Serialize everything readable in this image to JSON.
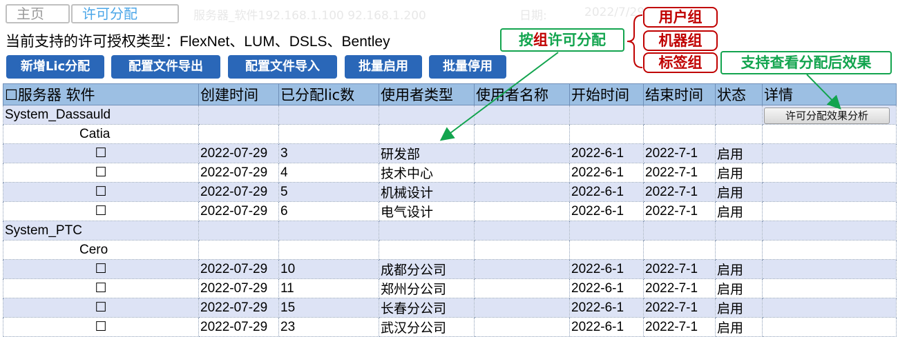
{
  "tabs": {
    "home": "主页",
    "active": "许可分配"
  },
  "faded_header": {
    "server_info": "服务器_软件192.168.1.100 92.168.1.200",
    "date_label": "日期:",
    "date_value": "2022/7/29"
  },
  "support_line": {
    "label": "当前支持的许可授权类型：",
    "types": "FlexNet、LUM、DSLS、Bentley"
  },
  "toolbar": {
    "add_lic": "新增Lic分配",
    "export_config": "配置文件导出",
    "import_config": "配置文件导入",
    "batch_enable": "批量启用",
    "batch_disable": "批量停用"
  },
  "annotations": {
    "group_alloc": {
      "prefix": "按",
      "highlight": "组",
      "suffix": "许可分配"
    },
    "user_group": "用户组",
    "machine_group": "机器组",
    "tag_group": "标签组",
    "view_effect": "支持查看分配后效果"
  },
  "table": {
    "headers": {
      "server_software": "☐服务器 软件",
      "created": "创建时间",
      "lic_count": "已分配lic数",
      "user_type": "使用者类型",
      "user_name": "使用者名称",
      "start": "开始时间",
      "end": "结束时间",
      "status": "状态",
      "detail": "详情"
    },
    "detail_button": "许可分配效果分析",
    "systems": [
      {
        "name": "System_Dassauld",
        "software": "Catia",
        "rows": [
          {
            "check": "☐",
            "created": "2022-07-29",
            "count": "3",
            "user_type": "研发部",
            "user_name": "",
            "start": "2022-6-1",
            "end": "2022-7-1",
            "status": "启用"
          },
          {
            "check": "☐",
            "created": "2022-07-29",
            "count": "4",
            "user_type": "技术中心",
            "user_name": "",
            "start": "2022-6-1",
            "end": "2022-7-1",
            "status": "启用"
          },
          {
            "check": "☐",
            "created": "2022-07-29",
            "count": "5",
            "user_type": "机械设计",
            "user_name": "",
            "start": "2022-6-1",
            "end": "2022-7-1",
            "status": "启用"
          },
          {
            "check": "☐",
            "created": "2022-07-29",
            "count": "6",
            "user_type": "电气设计",
            "user_name": "",
            "start": "2022-6-1",
            "end": "2022-7-1",
            "status": "启用"
          }
        ]
      },
      {
        "name": "System_PTC",
        "software": "Cero",
        "rows": [
          {
            "check": "☐",
            "created": "2022-07-29",
            "count": "10",
            "user_type": "成都分公司",
            "user_name": "",
            "start": "2022-6-1",
            "end": "2022-7-1",
            "status": "启用"
          },
          {
            "check": "☐",
            "created": "2022-07-29",
            "count": "11",
            "user_type": "郑州分公司",
            "user_name": "",
            "start": "2022-6-1",
            "end": "2022-7-1",
            "status": "启用"
          },
          {
            "check": "☐",
            "created": "2022-07-29",
            "count": "15",
            "user_type": "长春分公司",
            "user_name": "",
            "start": "2022-6-1",
            "end": "2022-7-1",
            "status": "启用"
          },
          {
            "check": "☐",
            "created": "2022-07-29",
            "count": "23",
            "user_type": "武汉分公司",
            "user_name": "",
            "start": "2022-6-1",
            "end": "2022-7-1",
            "status": "启用"
          }
        ]
      }
    ]
  },
  "colors": {
    "button_blue": "#2a67b8",
    "header_blue": "#9cbfe3",
    "row_alt": "#dde3f5",
    "callout_red": "#c00000",
    "callout_green": "#12a44e",
    "tab_active": "#4aa6e8"
  }
}
